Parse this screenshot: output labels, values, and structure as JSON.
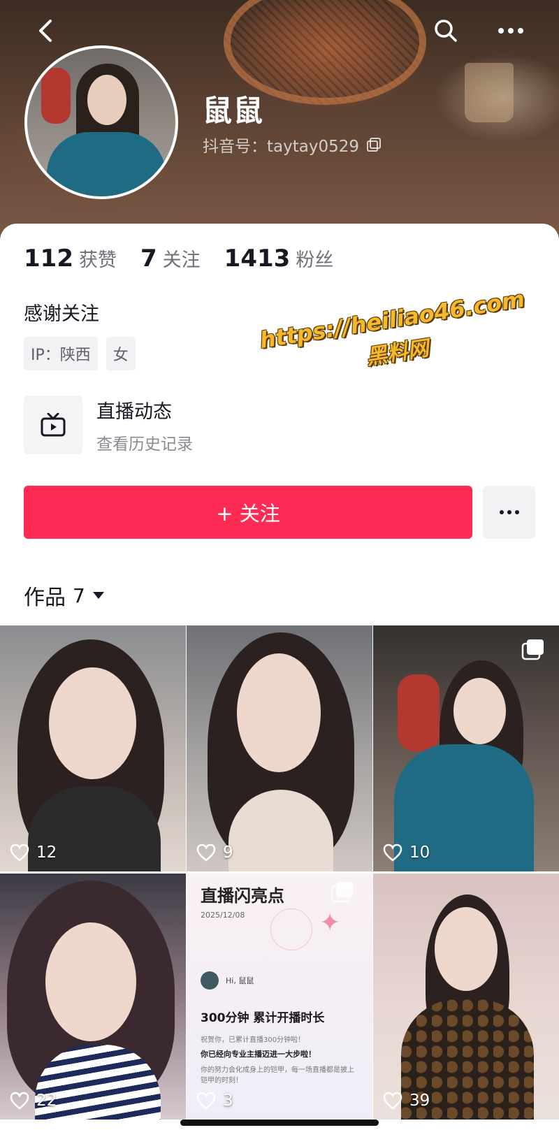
{
  "profile": {
    "nickname": "鼠鼠",
    "douyin_id": "抖音号：taytay0529",
    "bio": "感谢关注",
    "tags": [
      "IP：陕西",
      "女"
    ]
  },
  "stats": [
    {
      "value": "112",
      "label": "获赞"
    },
    {
      "value": "7",
      "label": "关注"
    },
    {
      "value": "1413",
      "label": "粉丝"
    }
  ],
  "live": {
    "title": "直播动态",
    "subtitle": "查看历史记录"
  },
  "actions": {
    "follow_label": "+ 关注"
  },
  "works": {
    "label": "作品",
    "count": "7"
  },
  "watermark": {
    "url": "https://heiliao46.com",
    "name": "黑料网"
  },
  "grid": [
    {
      "likes": "12",
      "multi": false
    },
    {
      "likes": "9",
      "multi": false
    },
    {
      "likes": "10",
      "multi": true
    },
    {
      "likes": "22",
      "multi": false
    },
    {
      "likes": "3",
      "multi": true
    },
    {
      "likes": "39",
      "multi": false
    }
  ],
  "poster": {
    "heading": "直播闪亮点",
    "date": "2025/12/08",
    "greeting": "Hi, 鼠鼠",
    "big": "300分钟 累计开播时长",
    "line1": "祝贺你，已累计直播300分钟啦！",
    "line2": "你已经向专业主播迈进一大步啦！",
    "line3": "你的努力会化成身上的铠甲，每一场直播都是披上铠甲的时刻！"
  },
  "icons": [
    "back-icon",
    "search-icon",
    "more-icon",
    "copy-icon",
    "tv-icon",
    "ellipsis-icon",
    "dropdown-icon",
    "heart-icon",
    "multi-image-icon"
  ],
  "colors": {
    "accent": "#fe2c55",
    "text": "#161823",
    "muted": "#8a8b91"
  }
}
